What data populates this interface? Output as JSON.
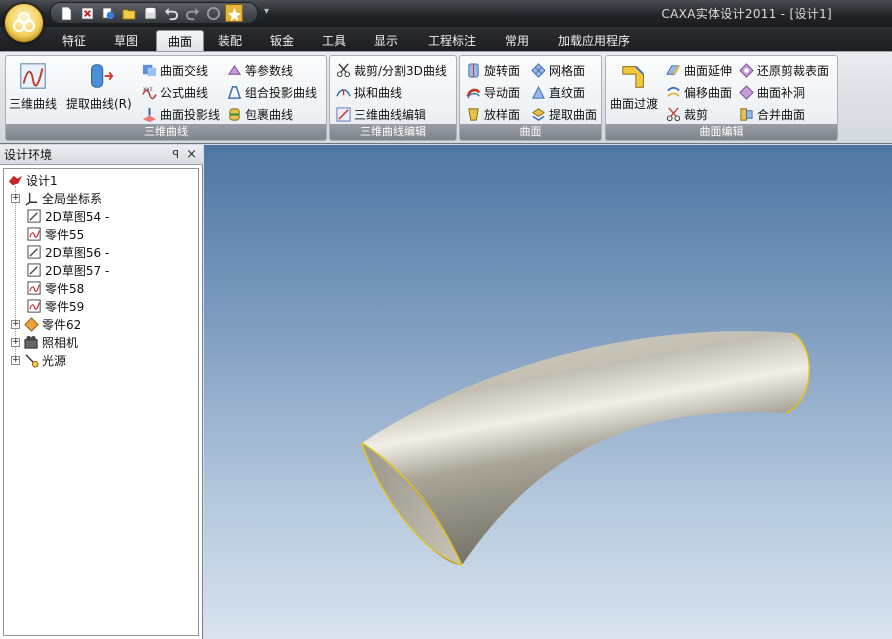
{
  "window": {
    "title": "CAXA实体设计2011 - [设计1]"
  },
  "quick_access": {
    "icons": [
      "new-icon",
      "close-doc-icon",
      "copy-icon",
      "open-icon",
      "save-icon",
      "undo-icon",
      "redo-icon",
      "rebuild-icon",
      "special-icon"
    ]
  },
  "tabs": [
    "特征",
    "草图",
    "曲面",
    "装配",
    "钣金",
    "工具",
    "显示",
    "工程标注",
    "常用",
    "加载应用程序"
  ],
  "active_tab": "曲面",
  "ribbon": {
    "group1": {
      "label": "三维曲线",
      "big": [
        "三维曲线",
        "提取曲线(R)"
      ],
      "small": [
        "曲面交线",
        "公式曲线",
        "曲面投影线",
        "等参数线",
        "组合投影曲线",
        "包裹曲线"
      ]
    },
    "group2": {
      "label": "三维曲线编辑",
      "small": [
        "裁剪/分割3D曲线",
        "拟和曲线",
        "三维曲线编辑"
      ]
    },
    "group3": {
      "label": "曲面",
      "small": [
        "旋转面",
        "导动面",
        "放样面",
        "网格面",
        "直纹面",
        "提取曲面"
      ]
    },
    "group4": {
      "label": "曲面编辑",
      "big": [
        "曲面过渡"
      ],
      "small": [
        "曲面延伸",
        "偏移曲面",
        "裁剪",
        "还原剪裁表面",
        "曲面补洞",
        "合并曲面"
      ]
    }
  },
  "panel": {
    "title": "设计环境",
    "pin": "ꟼ",
    "close": "×",
    "tree": [
      {
        "label": "设计1",
        "expand": ""
      },
      {
        "label": "全局坐标系",
        "expand": "+"
      },
      {
        "label": "2D草图54 -",
        "expand": ""
      },
      {
        "label": "零件55",
        "expand": ""
      },
      {
        "label": "2D草图56 -",
        "expand": ""
      },
      {
        "label": "2D草图57 -",
        "expand": ""
      },
      {
        "label": "零件58",
        "expand": ""
      },
      {
        "label": "零件59",
        "expand": ""
      },
      {
        "label": "零件62",
        "expand": "+"
      },
      {
        "label": "照相机",
        "expand": "+"
      },
      {
        "label": "光源",
        "expand": "+"
      }
    ]
  },
  "colors": {
    "viewport_top": "#4f76a3",
    "viewport_bottom": "#d9e4ef",
    "surface": "#b5b1a6",
    "edge": "#e8c300"
  }
}
